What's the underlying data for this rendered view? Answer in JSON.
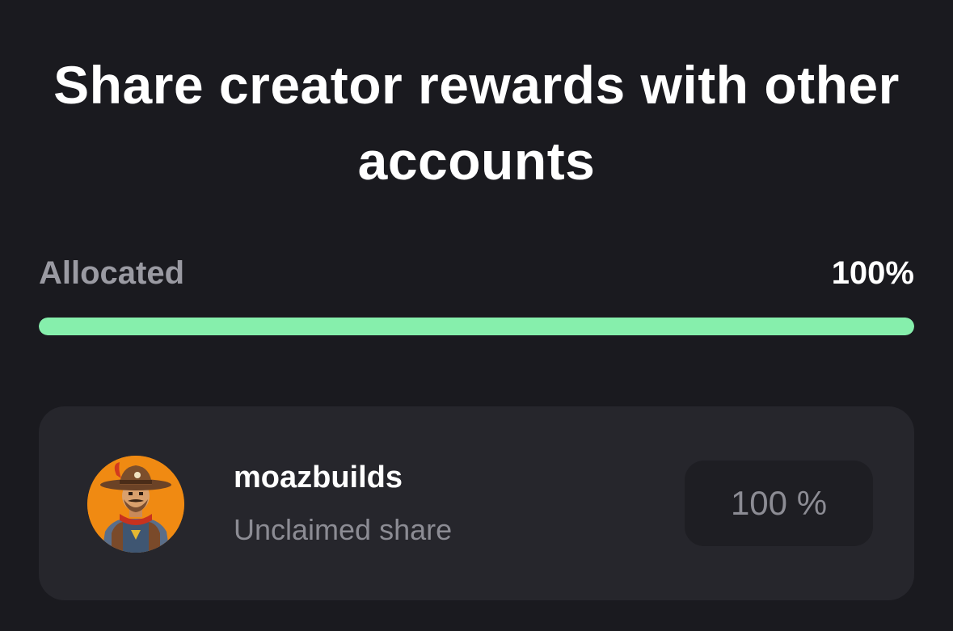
{
  "header": {
    "title": "Share creator rewards with other accounts"
  },
  "allocation": {
    "label": "Allocated",
    "value_text": "100%",
    "progress_percent": 100,
    "bar_color": "#86efac"
  },
  "recipients": [
    {
      "username": "moazbuilds",
      "status": "Unclaimed share",
      "share_value": "100 %",
      "avatar_icon": "pixel-art-cowboy-avatar"
    }
  ]
}
